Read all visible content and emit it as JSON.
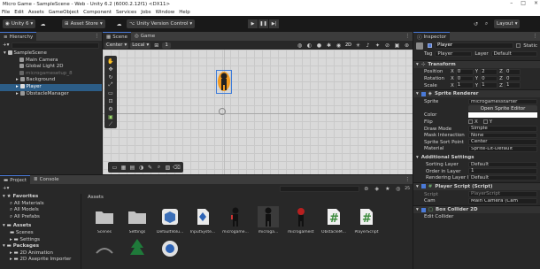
{
  "window": {
    "title": "Micro Game - SampleScene - Web - Unity 6.2 (6000.2.12f1) <DX11>",
    "minimize": "–",
    "maximize": "□",
    "close": "×"
  },
  "menu": [
    "File",
    "Edit",
    "Assets",
    "GameObject",
    "Component",
    "Services",
    "Jobs",
    "Window",
    "Help"
  ],
  "toolbar": {
    "account": "Unity 6",
    "asset_store": "Asset Store",
    "version_control": "Unity Version Control",
    "layout": "Layout"
  },
  "hierarchy": {
    "tab": "Hierarchy",
    "search_placeholder": "",
    "items": [
      {
        "label": "SampleScene",
        "depth": 0,
        "dim": false,
        "selected": false
      },
      {
        "label": "Main Camera",
        "depth": 2,
        "dim": false,
        "selected": false
      },
      {
        "label": "Global Light 2D",
        "depth": 2,
        "dim": false,
        "selected": false
      },
      {
        "label": "microgamesetup_8",
        "depth": 2,
        "dim": true,
        "selected": false
      },
      {
        "label": "Background",
        "depth": 1,
        "dim": false,
        "selected": false
      },
      {
        "label": "Player",
        "depth": 1,
        "dim": false,
        "selected": true
      },
      {
        "label": "ObstacleManager",
        "depth": 1,
        "dim": false,
        "selected": false
      }
    ]
  },
  "scene": {
    "tab_scene": "Scene",
    "tab_game": "Game",
    "pivot": "Center",
    "space": "Local",
    "snap": "1",
    "mode_2d": "2D",
    "accent_orange": "#f29a1f"
  },
  "inspector": {
    "tab": "Inspector",
    "object_name": "Player",
    "static_label": "Static",
    "tag_label": "Tag",
    "tag": "Player",
    "layer_label": "Layer",
    "layer": "Default",
    "transform": {
      "title": "Transform",
      "rows": [
        {
          "label": "Position",
          "x": "X",
          "xv": "0",
          "y": "Y",
          "yv": "2",
          "z": "Z",
          "zv": "0"
        },
        {
          "label": "Rotation",
          "x": "X",
          "xv": "0",
          "y": "Y",
          "yv": "0",
          "z": "Z",
          "zv": "0"
        },
        {
          "label": "Scale",
          "x": "X",
          "xv": "1",
          "y": "Y",
          "yv": "1",
          "z": "Z",
          "zv": "1"
        }
      ]
    },
    "sprite_renderer": {
      "title": "Sprite Renderer",
      "sprite_label": "Sprite",
      "sprite": "microgamesstarter",
      "open_editor": "Open Sprite Editor",
      "color_label": "Color",
      "flip_label": "Flip",
      "flip_x": "X",
      "flip_y": "Y",
      "draw_mode_label": "Draw Mode",
      "draw_mode": "Simple",
      "mask_label": "Mask Interaction",
      "mask": "None",
      "sort_point_label": "Sprite Sort Point",
      "sort_point": "Center",
      "material_label": "Material",
      "material": "Sprite-Lit-Default"
    },
    "additional": {
      "title": "Additional Settings",
      "sorting_layer_label": "Sorting Layer",
      "sorting_layer": "Default",
      "order_label": "Order in Layer",
      "order": "1",
      "rendering_layer_label": "Rendering Layer M",
      "rendering_layer": "Default"
    },
    "script": {
      "title": "Player Script (Script)",
      "script_label": "Script",
      "script": "PlayerScript",
      "cam_label": "Cam",
      "cam": "Main Camera (Cam"
    },
    "box_collider": {
      "title": "Box Collider 2D",
      "edit_label": "Edit Collider"
    }
  },
  "project": {
    "tab_project": "Project",
    "tab_console": "Console",
    "tree": [
      {
        "label": "Favorites",
        "depth": 0,
        "bold": true
      },
      {
        "label": "All Materials",
        "depth": 1
      },
      {
        "label": "All Models",
        "depth": 1
      },
      {
        "label": "All Prefabs",
        "depth": 1
      },
      {
        "label": "Assets",
        "depth": 0,
        "bold": true
      },
      {
        "label": "Scenes",
        "depth": 1
      },
      {
        "label": "Settings",
        "depth": 1
      },
      {
        "label": "Packages",
        "depth": 0,
        "bold": true
      },
      {
        "label": "2D Animation",
        "depth": 1
      },
      {
        "label": "2D Aseprite Importer",
        "depth": 1
      }
    ],
    "breadcrumb": "Assets",
    "assets": [
      {
        "label": "Scenes",
        "kind": "folder"
      },
      {
        "label": "Settings",
        "kind": "folder"
      },
      {
        "label": "DefaultVolu...",
        "kind": "cube"
      },
      {
        "label": "InputSyste...",
        "kind": "input"
      },
      {
        "label": "microgame...",
        "kind": "character"
      },
      {
        "label": "microga...",
        "kind": "character2"
      },
      {
        "label": "microgamest...",
        "kind": "enemy"
      },
      {
        "label": "ObstacleM...",
        "kind": "script"
      },
      {
        "label": "PlayerScript",
        "kind": "script"
      },
      {
        "label": "",
        "kind": "arc"
      },
      {
        "label": "",
        "kind": "tree"
      },
      {
        "label": "",
        "kind": "round"
      }
    ],
    "count": "25"
  }
}
